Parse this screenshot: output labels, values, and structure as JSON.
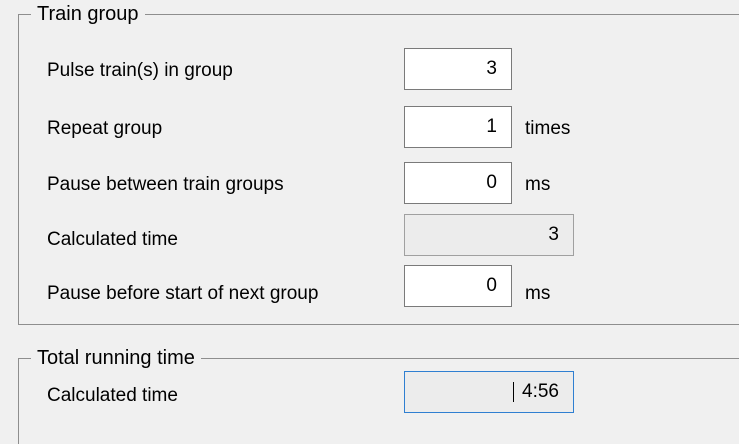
{
  "train_group": {
    "title": "Train group",
    "rows": [
      {
        "label": "Pulse train(s) in group",
        "value": "3",
        "unit": ""
      },
      {
        "label": "Repeat group",
        "value": "1",
        "unit": "times"
      },
      {
        "label": "Pause between train groups",
        "value": "0",
        "unit": "ms"
      },
      {
        "label": "Calculated time",
        "value": "3",
        "unit": ""
      },
      {
        "label": "Pause before start of next group",
        "value": "0",
        "unit": "ms"
      }
    ]
  },
  "total_running_time": {
    "title": "Total running time",
    "label": "Calculated time",
    "value": "4:56"
  },
  "colors": {
    "background": "#f0f0f0",
    "field_background": "#ffffff",
    "readonly_background": "#ececec",
    "focus_border": "#2f7fd1"
  }
}
